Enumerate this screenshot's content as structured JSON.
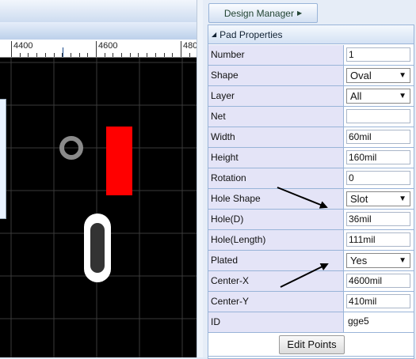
{
  "toolbar": {
    "design_manager_label": "Design Manager"
  },
  "ruler": {
    "labels": [
      "4400",
      "4600",
      "480"
    ]
  },
  "properties": {
    "header": "Pad Properties",
    "rows": [
      {
        "label": "Number",
        "value": "1",
        "kind": "input"
      },
      {
        "label": "Shape",
        "value": "Oval",
        "kind": "select"
      },
      {
        "label": "Layer",
        "value": "All",
        "kind": "select"
      },
      {
        "label": "Net",
        "value": "",
        "kind": "input"
      },
      {
        "label": "Width",
        "value": "60mil",
        "kind": "input"
      },
      {
        "label": "Height",
        "value": "160mil",
        "kind": "input"
      },
      {
        "label": "Rotation",
        "value": "0",
        "kind": "input"
      },
      {
        "label": "Hole Shape",
        "value": "Slot",
        "kind": "select"
      },
      {
        "label": "Hole(D)",
        "value": "36mil",
        "kind": "input"
      },
      {
        "label": "Hole(Length)",
        "value": "111mil",
        "kind": "input"
      },
      {
        "label": "Plated",
        "value": "Yes",
        "kind": "select"
      },
      {
        "label": "Center-X",
        "value": "4600mil",
        "kind": "input"
      },
      {
        "label": "Center-Y",
        "value": "410mil",
        "kind": "input"
      },
      {
        "label": "ID",
        "value": "gge5",
        "kind": "text"
      }
    ],
    "edit_points_label": "Edit Points"
  },
  "colors": {
    "canvas": "#000000",
    "grid": "#3a3a3a",
    "smd_pad": "#ff0000",
    "via_ring": "#8a8a8a",
    "slot_pad": "#ffffff",
    "slot_hole": "#333333",
    "accent": "#99b4d8"
  },
  "icons": {
    "design_manager_arrow": "triangle-right-icon",
    "header_arrow": "triangle-down-icon",
    "select_arrow": "chevron-down-icon"
  }
}
